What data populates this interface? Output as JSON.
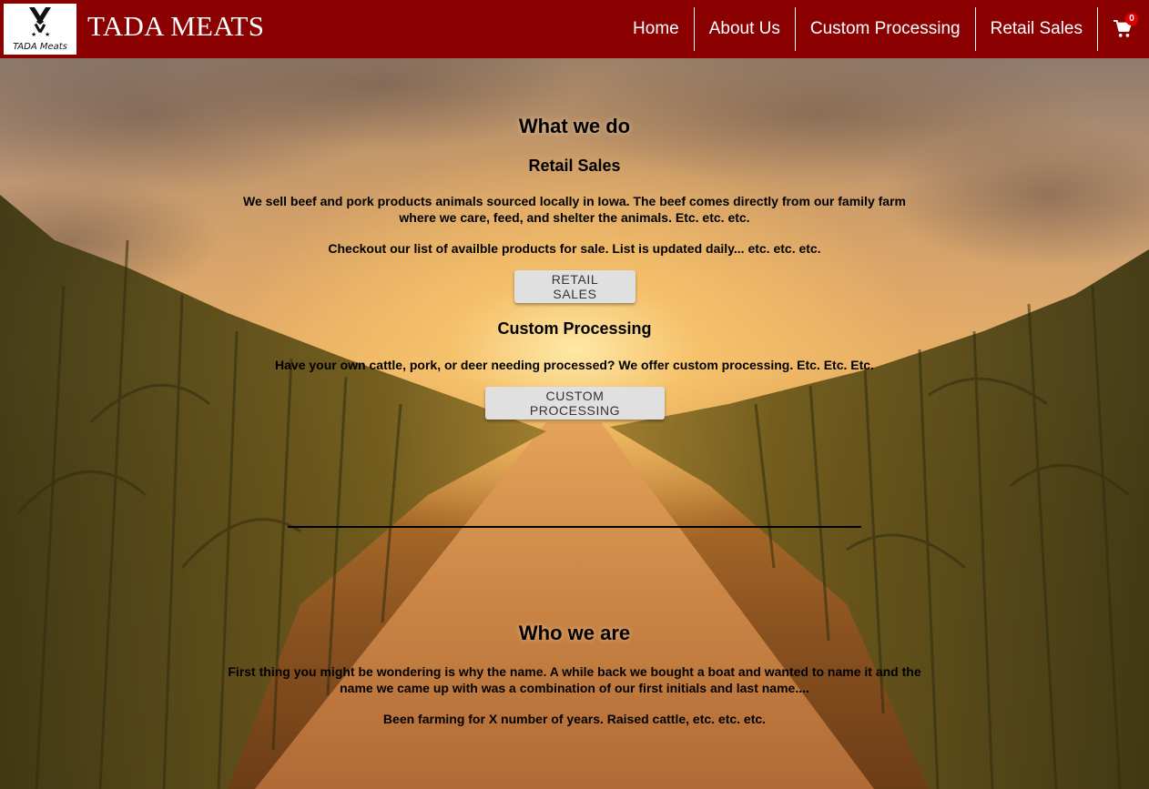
{
  "header": {
    "logo_text": "TADA Meats",
    "brand": "TADA MEATS",
    "nav": [
      "Home",
      "About Us",
      "Custom Processing",
      "Retail Sales"
    ],
    "cart_count": "0"
  },
  "what_we_do": {
    "title": "What we do",
    "retail": {
      "title": "Retail Sales",
      "p1": "We sell beef and pork products animals sourced locally in Iowa. The beef comes directly from our family farm where we care, feed, and shelter the animals. Etc. etc. etc.",
      "p2": "Checkout our list of availble products for sale. List is updated daily... etc. etc. etc.",
      "button": "RETAIL SALES"
    },
    "custom": {
      "title": "Custom Processing",
      "p1": "Have your own cattle, pork, or deer needing processed? We offer custom processing. Etc. Etc. Etc.",
      "button": "CUSTOM PROCESSING"
    }
  },
  "who_we_are": {
    "title": "Who we are",
    "p1": "First thing you might be wondering is why the name. A while back we bought a boat and wanted to name it and the name we came up with was a combination of our first initials and last name....",
    "p2": "Been farming for X number of years. Raised cattle, etc. etc. etc."
  },
  "colors": {
    "header_bg": "#8b0000",
    "button_bg": "#e0e0e0",
    "cart_badge": "#e00000"
  },
  "icons": [
    "crossed-cleavers-icon",
    "cart-icon"
  ]
}
